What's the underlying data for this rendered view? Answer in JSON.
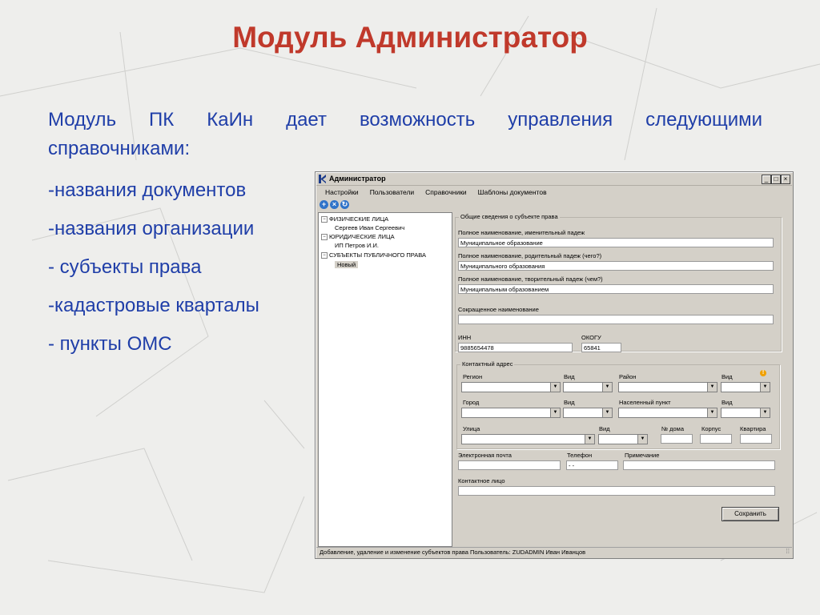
{
  "slide": {
    "title": "Модуль Администратор",
    "intro_line1": "Модуль ПК КаИн дает возможность управления следующими",
    "intro_line2": "справочниками:",
    "bullets": [
      "-названия документов",
      "-названия организации",
      "- субъекты права",
      "-кадастровые кварталы",
      "- пункты ОМС"
    ]
  },
  "window": {
    "title": "Администратор",
    "controls": {
      "minimize": "_",
      "maximize": "□",
      "close": "×"
    },
    "menu": [
      "Настройки",
      "Пользователи",
      "Справочники",
      "Шаблоны документов"
    ],
    "toolbar": [
      "+",
      "×",
      "↻"
    ],
    "tree": {
      "physical": "ФИЗИЧЕСКИЕ ЛИЦА",
      "physical_child": "Сергеев Иван Сергеевич",
      "legal": "ЮРИДИЧЕСКИЕ ЛИЦА",
      "legal_child": "ИП Петров И.И.",
      "public": "СУБЪЕКТЫ ПУБЛИЧНОГО ПРАВА",
      "public_child": "Новый"
    },
    "general": {
      "legend": "Общие сведения о субъекте права",
      "full_nom_label": "Полное наименование, именительный падеж",
      "full_nom_value": "Муниципальное образование",
      "full_gen_label": "Полное наименование, родительный падеж (чего?)",
      "full_gen_value": "Муниципального образования",
      "full_ins_label": "Полное наименование, творительный падеж (чем?)",
      "full_ins_value": "Муниципальным образованием",
      "short_label": "Сокращенное наименование",
      "short_value": "",
      "inn_label": "ИНН",
      "inn_value": "9885654478",
      "okogu_label": "ОКОГУ",
      "okogu_value": "65841"
    },
    "address": {
      "legend": "Контактный адрес",
      "region": "Регион",
      "vid": "Вид",
      "district": "Район",
      "city": "Город",
      "settlement": "Населенный пункт",
      "street": "Улица",
      "house": "№ дома",
      "building": "Корпус",
      "flat": "Квартира",
      "warn": "!"
    },
    "contacts": {
      "email_label": "Электронная почта",
      "phone_label": "Телефон",
      "phone_value": "-  -",
      "note_label": "Примечание",
      "person_label": "Контактное лицо"
    },
    "save_label": "Сохранить",
    "status": "Добавление, удаление и изменение субъектов права    Пользователь: ZUDADMIN   Иван Иванцов",
    "grip": "⁞⁞"
  }
}
